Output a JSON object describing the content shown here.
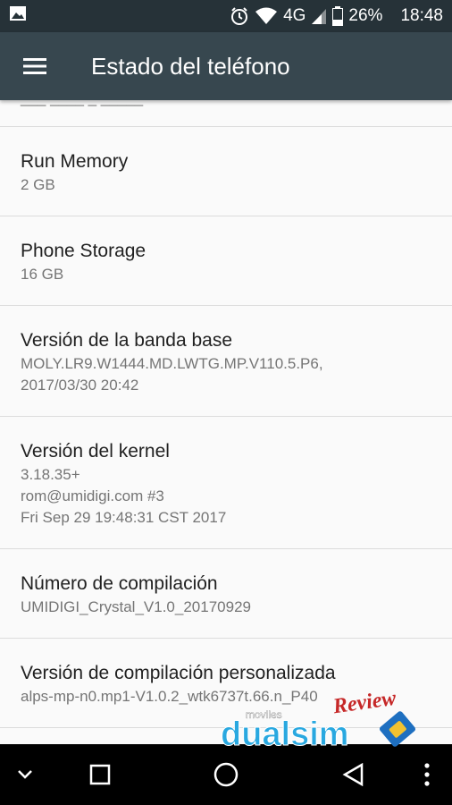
{
  "status_bar": {
    "network": "4G",
    "battery": "26%",
    "time": "18:48",
    "icons": [
      "image-icon",
      "alarm-icon",
      "wifi-icon",
      "signal-icon",
      "battery-icon"
    ]
  },
  "toolbar": {
    "title": "Estado del teléfono",
    "menu_icon": "hamburger-menu-icon"
  },
  "partial_row": {
    "text": "___ ____ _ _____"
  },
  "rows": [
    {
      "title": "Run Memory",
      "summary": "2 GB"
    },
    {
      "title": "Phone Storage",
      "summary": "16 GB"
    },
    {
      "title": "Versión de la banda base",
      "summary": "MOLY.LR9.W1444.MD.LWTG.MP.V110.5.P6,\n2017/03/30 20:42"
    },
    {
      "title": "Versión del kernel",
      "summary": "3.18.35+\nrom@umidigi.com #3\nFri Sep 29 19:48:31 CST 2017"
    },
    {
      "title": "Número de compilación",
      "summary": "UMIDIGI_Crystal_V1.0_20170929"
    },
    {
      "title": "Versión de compilación personalizada",
      "summary": "alps-mp-n0.mp1-V1.0.2_wtk6737t.66.n_P40"
    }
  ],
  "watermark": {
    "top": "moviles",
    "brand": "dualsim",
    "badge": "Review"
  },
  "nav_bar": {
    "icons": [
      "collapse-icon",
      "recents-icon",
      "home-icon",
      "back-icon",
      "more-icon"
    ]
  },
  "colors": {
    "status_bar": "#263238",
    "toolbar": "#37474f",
    "background": "#fafafa",
    "primary_text": "#212121",
    "secondary_text": "#757575"
  }
}
